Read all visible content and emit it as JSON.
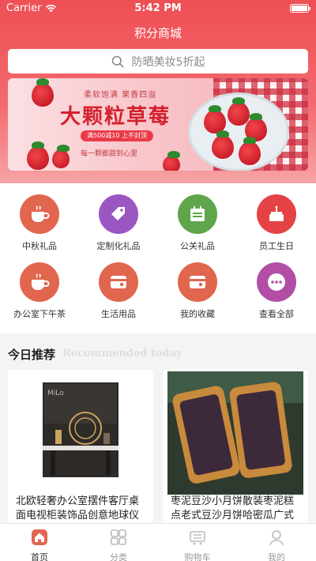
{
  "status_bar": {
    "carrier": "Carrier",
    "time": "5:42 PM"
  },
  "nav": {
    "title": "积分商城"
  },
  "search": {
    "placeholder": "防晒美妆5折起"
  },
  "banner": {
    "subtitle": "柔软饱满 果香四溢",
    "title": "大颗粒草莓",
    "promo": "满500减10 上不封顶",
    "tagline": "每一颗都甜到心里"
  },
  "categories": [
    {
      "label": "中秋礼品",
      "icon": "cup-icon",
      "color": "#e0664e"
    },
    {
      "label": "定制化礼品",
      "icon": "tag-icon",
      "color": "#9a57c2"
    },
    {
      "label": "公关礼品",
      "icon": "calendar-icon",
      "color": "#5ea54b"
    },
    {
      "label": "员工生日",
      "icon": "cake-icon",
      "color": "#e44245"
    },
    {
      "label": "办公室下午茶",
      "icon": "cup-icon",
      "color": "#e0664e"
    },
    {
      "label": "生活用品",
      "icon": "wallet-icon",
      "color": "#e0664e"
    },
    {
      "label": "我的收藏",
      "icon": "wallet-icon",
      "color": "#e0664e"
    },
    {
      "label": "查看全部",
      "icon": "more-icon",
      "color": "#b24ea6"
    }
  ],
  "recommend": {
    "title": "今日推荐",
    "subtitle_en": "Recommended today"
  },
  "products": [
    {
      "name": "北欧轻奢办公室摆件客厅桌面电视柜装饰品创意地球仪"
    },
    {
      "name": "枣泥豆沙小月饼散装枣泥糕点老式豆沙月饼哈密瓜广式"
    }
  ],
  "tabbar": [
    {
      "label": "首页",
      "icon": "home-icon",
      "active": true
    },
    {
      "label": "分类",
      "icon": "grid-icon",
      "active": false
    },
    {
      "label": "购物车",
      "icon": "cart-icon",
      "active": false
    },
    {
      "label": "我的",
      "icon": "user-icon",
      "active": false
    }
  ],
  "colors": {
    "brand": "#ee4f55",
    "active_tab": "#e0664e"
  }
}
